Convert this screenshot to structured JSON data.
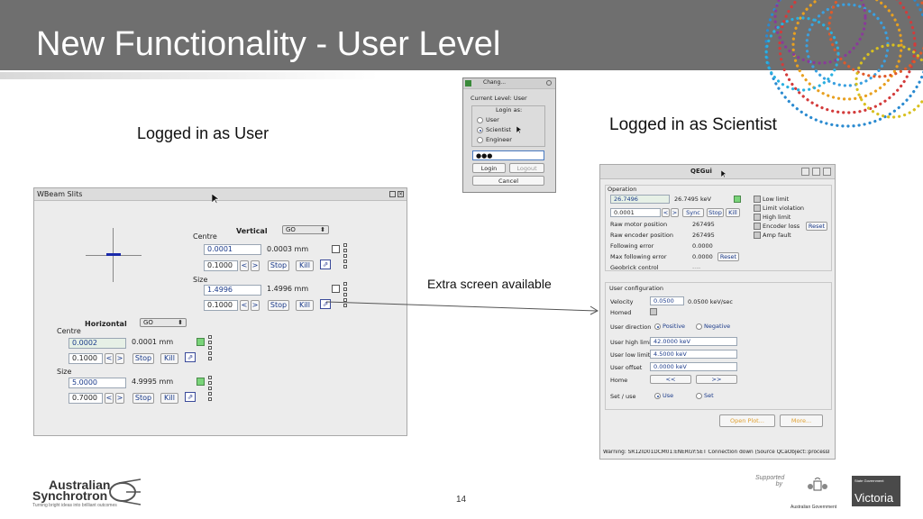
{
  "slide": {
    "title": "New Functionality - User Level",
    "caption_user": "Logged in as User",
    "caption_scientist": "Logged in as Scientist",
    "caption_extra": "Extra screen available",
    "page_number": "14",
    "logo_line1": "Australian",
    "logo_line2": "Synchrotron",
    "logo_tagline": "Turning bright ideas into brilliant outcomes",
    "supported_by": "Supported by",
    "gov_label": "Australian Government",
    "vic_label": "Victoria",
    "vic_small": "State Government"
  },
  "wbeam": {
    "title": "WBeam Slits",
    "vertical": {
      "label": "Vertical",
      "mode": "GO",
      "centre_label": "Centre",
      "centre_value": "0.0001",
      "centre_readback": "0.0003 mm",
      "centre_step": "0.1000",
      "size_label": "Size",
      "size_value": "1.4996",
      "size_readback": "1.4996 mm",
      "size_step": "0.1000"
    },
    "horizontal": {
      "label": "Horizontal",
      "mode": "GO",
      "centre_label": "Centre",
      "centre_value": "0.0002",
      "centre_readback": "0.0001 mm",
      "centre_step": "0.1000",
      "size_label": "Size",
      "size_value": "5.0000",
      "size_readback": "4.9995 mm",
      "size_step": "0.7000"
    },
    "btn_left": "<",
    "btn_right": ">",
    "btn_stop": "Stop",
    "btn_kill": "Kill"
  },
  "login": {
    "title": "Chang...",
    "current_level": "Current Level: User",
    "login_as": "Login as:",
    "options": [
      "User",
      "Scientist",
      "Engineer"
    ],
    "password": "●●●",
    "btn_login": "Login",
    "btn_logout": "Logout",
    "btn_cancel": "Cancel"
  },
  "qegui": {
    "title": "QEGui",
    "operation": {
      "group_label": "Operation",
      "setpoint": "26.7496",
      "readback": "26.7495 keV",
      "step": "0.0001",
      "btn_left": "<",
      "btn_right": ">",
      "btn_sync": "Sync",
      "btn_stop": "Stop",
      "btn_kill": "Kill",
      "raw_motor_label": "Raw motor position",
      "raw_motor_value": "267495",
      "raw_encoder_label": "Raw encoder position",
      "raw_encoder_value": "267495",
      "following_error_label": "Following error",
      "following_error_value": "0.0000",
      "max_following_label": "Max following error",
      "max_following_value": "0.0000",
      "btn_reset": "Reset",
      "geobrick_label": "Geobrick control",
      "geobrick_value": "----",
      "low_limit": "Low limit",
      "limit_violation": "Limit violation",
      "high_limit": "High limit",
      "encoder_loss": "Encoder loss",
      "btn_reset2": "Reset",
      "amp_fault": "Amp fault"
    },
    "user_config": {
      "group_label": "User configuration",
      "velocity_label": "Velocity",
      "velocity_value": "0.0500",
      "velocity_readback": "0.0500 keV/sec",
      "homed_label": "Homed",
      "direction_label": "User direction",
      "dir_positive": "Positive",
      "dir_negative": "Negative",
      "high_limit_label": "User high limit",
      "high_limit_value": "42.0000 keV",
      "low_limit_label": "User low limit",
      "low_limit_value": "4.5000 keV",
      "offset_label": "User offset",
      "offset_value": "0.0000 keV",
      "home_label": "Home",
      "home_left": "<<",
      "home_right": ">>",
      "setuse_label": "Set / use",
      "use_label": "Use",
      "set_label": "Set"
    },
    "btn_open_plot": "Open Plot...",
    "btn_more": "More...",
    "status": "Warning: SR12ID01DCM01:ENERGY:SET Connection down (Source QCaObject::processI"
  },
  "colors": {
    "title_bar": "#6f6f6f",
    "field_text": "#1a3a8a",
    "led_green": "#7ad47a"
  }
}
